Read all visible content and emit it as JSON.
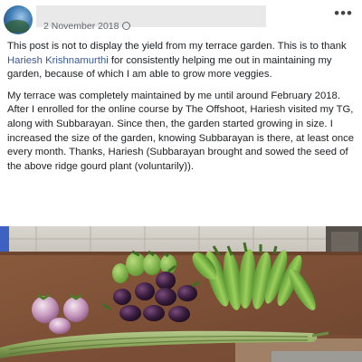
{
  "post": {
    "date": "2 November 2018",
    "privacy_icon": "globe-icon",
    "more_icon": "more-options-icon",
    "paragraph1": {
      "before": "This post is not to display the yield from my terrace garden. This is to thank ",
      "mention": "Hariesh Krishnamurthi",
      "after": " for consistently helping me out in maintaining my garden, because of which I am able to grow more veggies."
    },
    "paragraph2": "My terrace was completely maintained by me until around February 2018. After I enrolled for the online course by The Offshoot, Hariesh visited my TG, along with Subbarayan. Since then, the garden started growing in size. I increased the size of the garden, knowing Subbarayan is there, at least once every month. Thanks, Hariesh (Subbarayan brought and sowed the seed of the above ridge gourd plant (voluntarily)).",
    "mention_color": "#385898"
  }
}
